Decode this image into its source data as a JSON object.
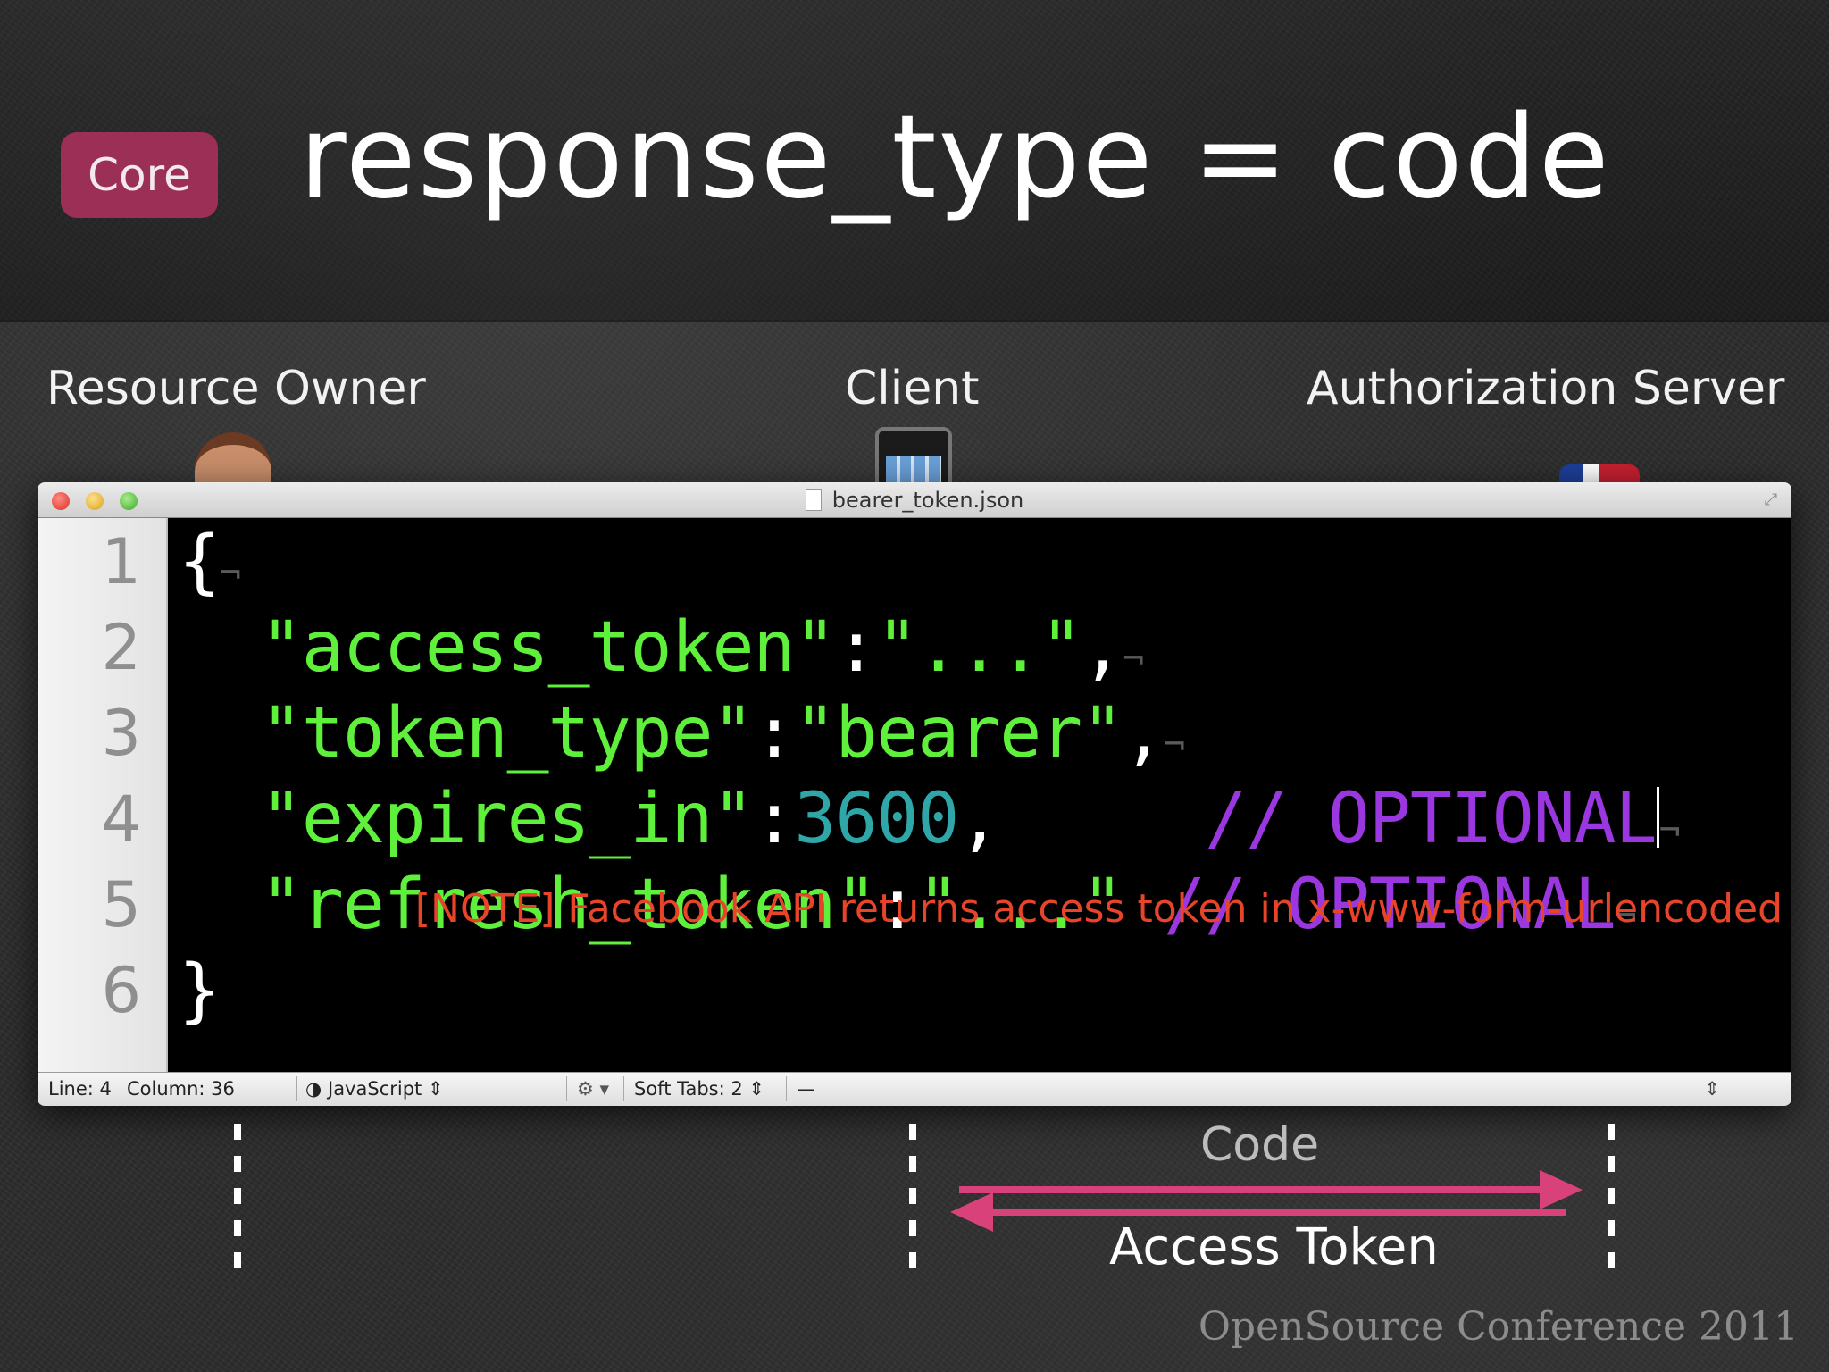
{
  "slide": {
    "badge": "Core",
    "title": "response_type = code"
  },
  "actors": {
    "resource_owner": "Resource Owner",
    "client": "Client",
    "authorization_server": "Authorization Server"
  },
  "editor": {
    "filename": "bearer_token.json",
    "line_numbers": [
      "1",
      "2",
      "3",
      "4",
      "5",
      "6"
    ],
    "code": {
      "l1_open": "{",
      "l2_key": "\"access_token\"",
      "l2_colon": ":",
      "l2_val": "\"...\"",
      "l2_comma": ",",
      "l3_key": "\"token_type\"",
      "l3_colon": ":",
      "l3_val": "\"bearer\"",
      "l3_comma": ",",
      "l4_key": "\"expires_in\"",
      "l4_colon": ":",
      "l4_val": "3600",
      "l4_comma": ",",
      "l4_comment": "// OPTIONAL",
      "l5_key": "\"refresh_token\"",
      "l5_colon": ":",
      "l5_val": "\"...\"",
      "l5_comment": "// OPTIONAL",
      "l6_close": "}",
      "invisible_newline": "¬"
    },
    "note": "[NOTE] Facebook API returns access token in x-www-form-urlencoded",
    "status": {
      "line": "Line: 4",
      "column": "Column: 36",
      "language": "JavaScript",
      "soft_tabs": "Soft Tabs:   2",
      "symbol": "—"
    }
  },
  "flow": {
    "code_label": "Code",
    "token_label": "Access Token",
    "arrow_color": "#d9417a"
  },
  "footer": "OpenSource Conference 2011",
  "colors": {
    "badge": "#9c2f55",
    "string": "#5ef03a",
    "number": "#2fa7a9",
    "comment": "#9a37e0",
    "note": "#e8442a"
  }
}
